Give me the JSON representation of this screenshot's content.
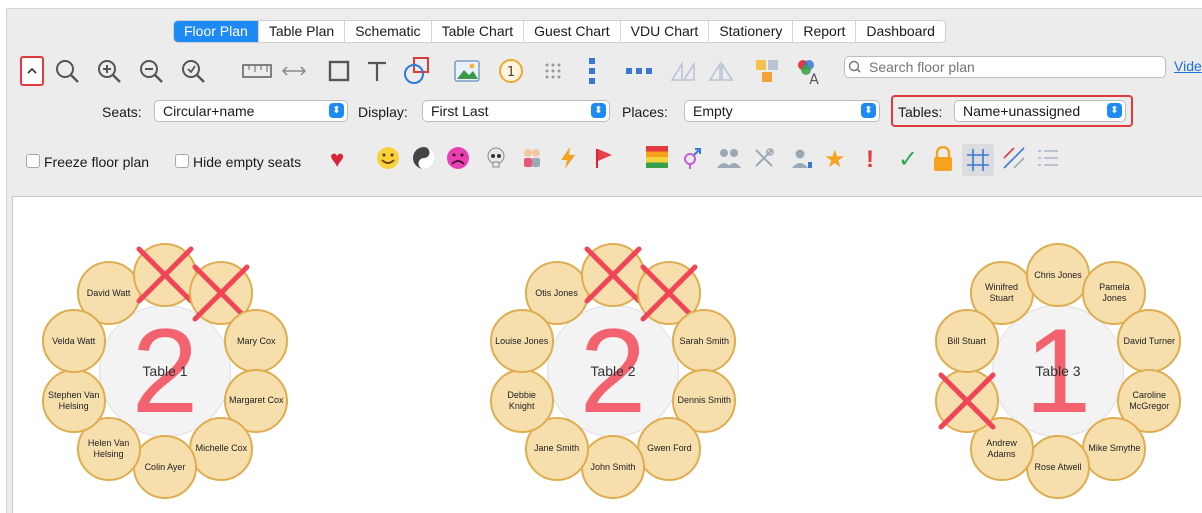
{
  "tabs": [
    {
      "label": "Floor Plan",
      "active": true
    },
    {
      "label": "Table Plan"
    },
    {
      "label": "Schematic"
    },
    {
      "label": "Table Chart"
    },
    {
      "label": "Guest Chart"
    },
    {
      "label": "VDU Chart"
    },
    {
      "label": "Stationery"
    },
    {
      "label": "Report"
    },
    {
      "label": "Dashboard"
    }
  ],
  "toolbar": {
    "search_placeholder": "Search floor plan",
    "video_link": "Vide",
    "accent": "#1e8af6",
    "highlight": "#e0393e"
  },
  "options": {
    "seats_label": "Seats:",
    "seats_value": "Circular+name",
    "display_label": "Display:",
    "display_value": "First Last",
    "places_label": "Places:",
    "places_value": "Empty",
    "tables_label": "Tables:",
    "tables_value": "Name+unassigned"
  },
  "filters": {
    "freeze_label": "Freeze floor plan",
    "hide_empty_label": "Hide empty seats"
  },
  "tables": [
    {
      "name": "Table 1",
      "unassigned": "2",
      "seats": [
        {
          "name": "David Watt"
        },
        {
          "name": "",
          "empty": true
        },
        {
          "name": "",
          "empty": true
        },
        {
          "name": "Mary Cox"
        },
        {
          "name": "Margaret Cox"
        },
        {
          "name": "Michelle Cox"
        },
        {
          "name": "Colin Ayer"
        },
        {
          "name": "Helen Van Helsing"
        },
        {
          "name": "Stephen Van Helsing"
        },
        {
          "name": "Velda Watt"
        }
      ]
    },
    {
      "name": "Table 2",
      "unassigned": "2",
      "seats": [
        {
          "name": "Otis Jones"
        },
        {
          "name": "",
          "empty": true
        },
        {
          "name": "",
          "empty": true
        },
        {
          "name": "Sarah Smith"
        },
        {
          "name": "Dennis Smith"
        },
        {
          "name": "Gwen Ford"
        },
        {
          "name": "John Smith"
        },
        {
          "name": "Jane Smith"
        },
        {
          "name": "Debbie Knight"
        },
        {
          "name": "Louise Jones"
        }
      ]
    },
    {
      "name": "Table 3",
      "unassigned": "1",
      "seats": [
        {
          "name": "Winifred Stuart"
        },
        {
          "name": "Chris Jones"
        },
        {
          "name": "Pamela Jones"
        },
        {
          "name": "David Turner"
        },
        {
          "name": "Caroline McGregor"
        },
        {
          "name": "Mike Smythe"
        },
        {
          "name": "Rose Atwell"
        },
        {
          "name": "Andrew Adams"
        },
        {
          "name": "",
          "empty": true
        },
        {
          "name": "Bill Stuart"
        }
      ]
    }
  ]
}
